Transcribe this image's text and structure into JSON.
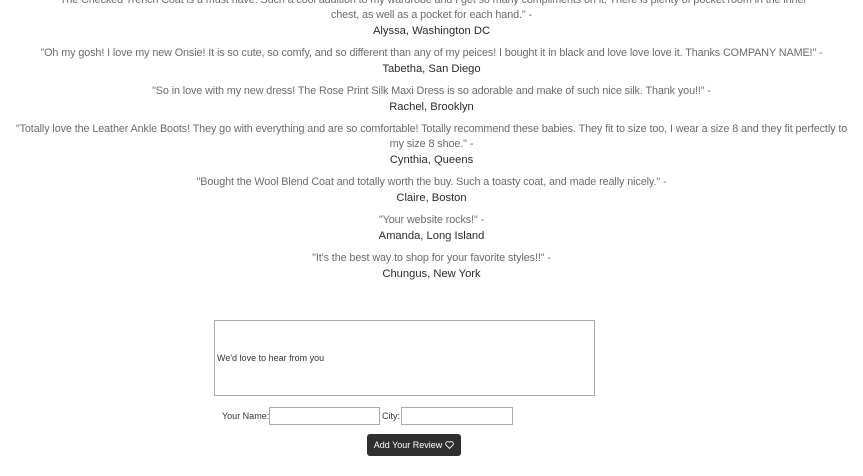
{
  "reviews": [
    {
      "quote": "\"The Checked Trench Coat is a must have. Such a cool addition to my wardrobe and I get so many compliments on it. There is plenty of pocket room in the inner chest, as well as a pocket for each hand.\" -",
      "author": "Alyssa, Washington DC"
    },
    {
      "quote": "\"Oh my gosh! I love my new Onsie! It is so cute, so comfy, and so different than any of my peices! I bought it in black and love love love it. Thanks COMPANY NAME!\" -",
      "author": "Tabetha, San Diego"
    },
    {
      "quote": "\"So in love with my new dress! The Rose Print Silk Maxi Dress is so adorable and make of such nice silk. Thank you!!\" -",
      "author": "Rachel, Brooklyn"
    },
    {
      "quote": "\"Totally love the Leather Ankle Boots! They go with everything and are so comfortable! Totally recommend these babies. They fit to size too, I wear a size 8 and they fit perfectly to my size 8 shoe.\" -",
      "author": "Cynthia, Queens"
    },
    {
      "quote": "\"Bought the Wool Blend Coat and totally worth the buy. Such a toasty coat, and made really nicely.\" -",
      "author": "Claire, Boston"
    },
    {
      "quote": "\"Your website rocks!\" -",
      "author": "Amanda, Long Island"
    },
    {
      "quote": "\"It's the best way to shop for your favorite styles!!\" -",
      "author": "Chungus, New York"
    }
  ],
  "form": {
    "message_placeholder": "We'd love to hear from you",
    "name_label": "Your Name:",
    "name_value": "",
    "city_label": "City:",
    "city_value": "",
    "submit_label": "Add Your Review",
    "submit_icon": "heart-outline-icon"
  }
}
